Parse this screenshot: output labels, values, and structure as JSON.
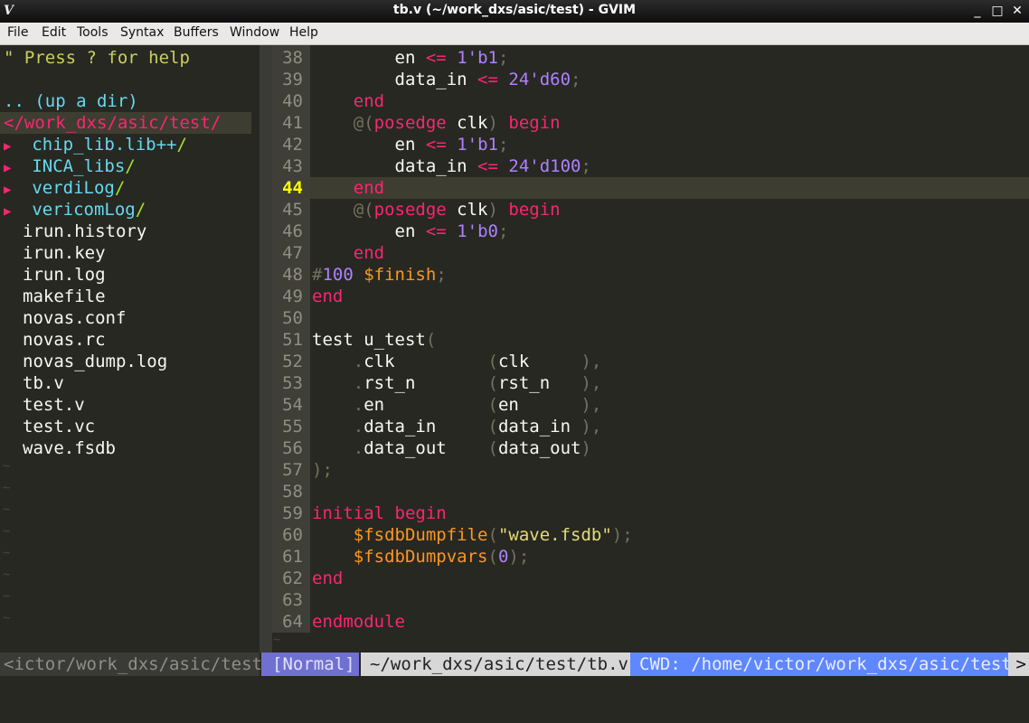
{
  "window": {
    "title": "tb.v (~/work_dxs/asic/test) - GVIM",
    "minimize": "_",
    "maximize": "□",
    "close": "✕",
    "app_icon": "vim-icon"
  },
  "menu": [
    "File",
    "Edit",
    "Tools",
    "Syntax",
    "Buffers",
    "Window",
    "Help"
  ],
  "tree": {
    "help": "\" Press ? for help",
    "updir": ".. (up a dir)",
    "root": "</work_dxs/asic/test/",
    "dirs": [
      {
        "arrow": "▶",
        "name": "chip_lib.lib++",
        "slash": "/"
      },
      {
        "arrow": "▶",
        "name": "INCA_libs",
        "slash": "/"
      },
      {
        "arrow": "▶",
        "name": "verdiLog",
        "slash": "/"
      },
      {
        "arrow": "▶",
        "name": "vericomLog",
        "slash": "/"
      }
    ],
    "files": [
      "irun.history",
      "irun.key",
      "irun.log",
      "makefile",
      "novas.conf",
      "novas.rc",
      "novas_dump.log",
      "tb.v",
      "test.v",
      "test.vc",
      "wave.fsdb"
    ],
    "tilde": "~"
  },
  "code": {
    "current_line": 44,
    "line_numbers": [
      "38",
      "39",
      "40",
      "41",
      "42",
      "43",
      "44",
      "45",
      "46",
      "47",
      "48",
      "49",
      "50",
      "51",
      "52",
      "53",
      "54",
      "55",
      "56",
      "57",
      "58",
      "59",
      "60",
      "61",
      "62",
      "63",
      "64"
    ],
    "lines": [
      [
        [
          "        ",
          "w"
        ],
        [
          "en",
          "w"
        ],
        [
          " ",
          "w"
        ],
        [
          "<=",
          "o"
        ],
        [
          " ",
          "w"
        ],
        [
          "1'b1",
          "p"
        ],
        [
          ";",
          "g"
        ]
      ],
      [
        [
          "        ",
          "w"
        ],
        [
          "data_in",
          "w"
        ],
        [
          " ",
          "w"
        ],
        [
          "<=",
          "o"
        ],
        [
          " ",
          "w"
        ],
        [
          "24'd60",
          "p"
        ],
        [
          ";",
          "g"
        ]
      ],
      [
        [
          "    ",
          "w"
        ],
        [
          "end",
          "k"
        ]
      ],
      [
        [
          "    ",
          "w"
        ],
        [
          "@(",
          "g"
        ],
        [
          "posedge",
          "k"
        ],
        [
          " clk",
          "w"
        ],
        [
          ")",
          "g"
        ],
        [
          " ",
          "w"
        ],
        [
          "begin",
          "k"
        ]
      ],
      [
        [
          "        ",
          "w"
        ],
        [
          "en",
          "w"
        ],
        [
          " ",
          "w"
        ],
        [
          "<=",
          "o"
        ],
        [
          " ",
          "w"
        ],
        [
          "1'b1",
          "p"
        ],
        [
          ";",
          "g"
        ]
      ],
      [
        [
          "        ",
          "w"
        ],
        [
          "data_in",
          "w"
        ],
        [
          " ",
          "w"
        ],
        [
          "<=",
          "o"
        ],
        [
          " ",
          "w"
        ],
        [
          "24'd100",
          "p"
        ],
        [
          ";",
          "g"
        ]
      ],
      [
        [
          "    ",
          "w"
        ],
        [
          "end",
          "k"
        ]
      ],
      [
        [
          "    ",
          "w"
        ],
        [
          "@(",
          "g"
        ],
        [
          "posedge",
          "k"
        ],
        [
          " clk",
          "w"
        ],
        [
          ")",
          "g"
        ],
        [
          " ",
          "w"
        ],
        [
          "begin",
          "k"
        ]
      ],
      [
        [
          "        ",
          "w"
        ],
        [
          "en",
          "w"
        ],
        [
          " ",
          "w"
        ],
        [
          "<=",
          "o"
        ],
        [
          " ",
          "w"
        ],
        [
          "1'b0",
          "p"
        ],
        [
          ";",
          "g"
        ]
      ],
      [
        [
          "    ",
          "w"
        ],
        [
          "end",
          "k"
        ]
      ],
      [
        [
          "#",
          "g"
        ],
        [
          "100",
          "p"
        ],
        [
          " ",
          "w"
        ],
        [
          "$finish",
          "f"
        ],
        [
          ";",
          "g"
        ]
      ],
      [
        [
          "end",
          "k"
        ]
      ],
      [
        [
          "",
          "w"
        ]
      ],
      [
        [
          "test u_test",
          "w"
        ],
        [
          "(",
          "g"
        ]
      ],
      [
        [
          "    ",
          "w"
        ],
        [
          ".",
          "g"
        ],
        [
          "clk",
          "w"
        ],
        [
          "         ",
          "w"
        ],
        [
          "(",
          "g"
        ],
        [
          "clk",
          "w"
        ],
        [
          "     ",
          "w"
        ],
        [
          "),",
          "g"
        ]
      ],
      [
        [
          "    ",
          "w"
        ],
        [
          ".",
          "g"
        ],
        [
          "rst_n",
          "w"
        ],
        [
          "       ",
          "w"
        ],
        [
          "(",
          "g"
        ],
        [
          "rst_n",
          "w"
        ],
        [
          "   ",
          "w"
        ],
        [
          "),",
          "g"
        ]
      ],
      [
        [
          "    ",
          "w"
        ],
        [
          ".",
          "g"
        ],
        [
          "en",
          "w"
        ],
        [
          "          ",
          "w"
        ],
        [
          "(",
          "g"
        ],
        [
          "en",
          "w"
        ],
        [
          "      ",
          "w"
        ],
        [
          "),",
          "g"
        ]
      ],
      [
        [
          "    ",
          "w"
        ],
        [
          ".",
          "g"
        ],
        [
          "data_in",
          "w"
        ],
        [
          "     ",
          "w"
        ],
        [
          "(",
          "g"
        ],
        [
          "data_in",
          "w"
        ],
        [
          " ",
          "w"
        ],
        [
          "),",
          "g"
        ]
      ],
      [
        [
          "    ",
          "w"
        ],
        [
          ".",
          "g"
        ],
        [
          "data_out",
          "w"
        ],
        [
          "    ",
          "w"
        ],
        [
          "(",
          "g"
        ],
        [
          "data_out",
          "w"
        ],
        [
          ")",
          "g"
        ]
      ],
      [
        [
          ");",
          "g"
        ]
      ],
      [
        [
          "",
          "w"
        ]
      ],
      [
        [
          "initial",
          "k"
        ],
        [
          " ",
          "w"
        ],
        [
          "begin",
          "k"
        ]
      ],
      [
        [
          "    ",
          "w"
        ],
        [
          "$fsdbDumpfile",
          "f"
        ],
        [
          "(",
          "g"
        ],
        [
          "\"wave.fsdb\"",
          "y"
        ],
        [
          ");",
          "g"
        ]
      ],
      [
        [
          "    ",
          "w"
        ],
        [
          "$fsdbDumpvars",
          "f"
        ],
        [
          "(",
          "g"
        ],
        [
          "0",
          "p"
        ],
        [
          ");",
          "g"
        ]
      ],
      [
        [
          "end",
          "k"
        ]
      ],
      [
        [
          "",
          "w"
        ]
      ],
      [
        [
          "endmodule",
          "k"
        ]
      ]
    ],
    "tilde": "~"
  },
  "status": {
    "left": "<ictor/work_dxs/asic/test",
    "mode": "[Normal]",
    "file": "~/work_dxs/asic/test/tb.v",
    "cwd": "CWD: /home/victor/work_dxs/asic/test",
    "more": ">"
  },
  "colors": {
    "bg": "#272822",
    "keyword": "#f92672",
    "number": "#ae81ff",
    "function": "#fd971f",
    "string": "#e6db74",
    "dir": "#66d9ef",
    "status_mode": "#7070d0",
    "status_cwd": "#5f87ff",
    "cursor_line_nr": "#ffff00"
  }
}
